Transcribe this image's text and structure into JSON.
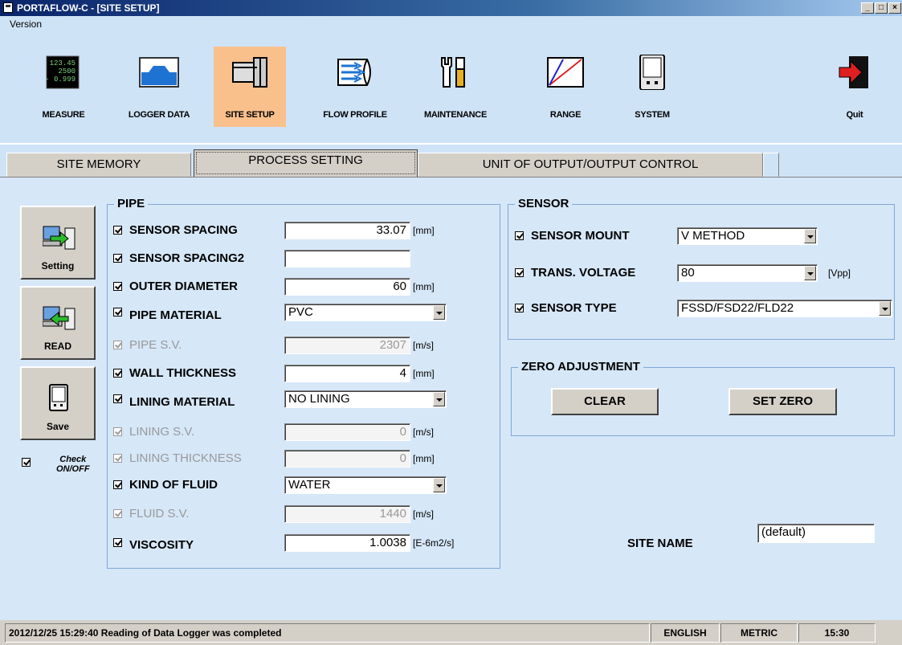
{
  "window": {
    "title": "PORTAFLOW-C - [SITE SETUP]",
    "controls": [
      "_",
      "□",
      "×"
    ]
  },
  "menu": {
    "items": [
      "Version"
    ]
  },
  "toolbar": {
    "items": [
      {
        "label": "MEASURE",
        "icon": "measure-display-icon",
        "display_lines": [
          "123.45",
          "2500",
          "- 0.999"
        ]
      },
      {
        "label": "LOGGER DATA",
        "icon": "logger-data-icon"
      },
      {
        "label": "SITE SETUP",
        "icon": "pipe-icon",
        "active": true
      },
      {
        "label": "FLOW PROFILE",
        "icon": "flow-profile-icon"
      },
      {
        "label": "MAINTENANCE",
        "icon": "tools-icon"
      },
      {
        "label": "RANGE",
        "icon": "range-graph-icon"
      },
      {
        "label": "SYSTEM",
        "icon": "device-icon"
      },
      {
        "label": "Quit",
        "icon": "exit-door-icon"
      }
    ]
  },
  "tabs": [
    {
      "label": "SITE MEMORY"
    },
    {
      "label": "PROCESS SETTING",
      "active": true
    },
    {
      "label": "UNIT OF OUTPUT/OUTPUT CONTROL"
    }
  ],
  "side_buttons": {
    "setting": "Setting",
    "read": "READ",
    "save": "Save",
    "check_onoff": [
      "Check",
      "ON/OFF"
    ]
  },
  "pipe": {
    "title": "PIPE",
    "rows": [
      {
        "label": "SENSOR SPACING",
        "value": "33.07",
        "unit": "[mm]"
      },
      {
        "label": "SENSOR SPACING2",
        "value": "",
        "unit": ""
      },
      {
        "label": "OUTER DIAMETER",
        "value": "60",
        "unit": "[mm]"
      },
      {
        "label": "PIPE MATERIAL",
        "value": "PVC",
        "unit": ""
      },
      {
        "label": "PIPE S.V.",
        "value": "2307",
        "unit": "[m/s]"
      },
      {
        "label": "WALL THICKNESS",
        "value": "4",
        "unit": "[mm]"
      },
      {
        "label": "LINING MATERIAL",
        "value": "NO LINING",
        "unit": ""
      },
      {
        "label": "LINING S.V.",
        "value": "0",
        "unit": "[m/s]"
      },
      {
        "label": "LINING THICKNESS",
        "value": "0",
        "unit": "[mm]"
      },
      {
        "label": "KIND OF FLUID",
        "value": "WATER",
        "unit": ""
      },
      {
        "label": "FLUID S.V.",
        "value": "1440",
        "unit": "[m/s]"
      },
      {
        "label": "VISCOSITY",
        "value": "1.0038",
        "unit": "[E-6m2/s]"
      }
    ]
  },
  "sensor": {
    "title": "SENSOR",
    "rows": [
      {
        "label": "SENSOR MOUNT",
        "value": "V METHOD",
        "unit": ""
      },
      {
        "label": "TRANS. VOLTAGE",
        "value": "80",
        "unit": "[Vpp]"
      },
      {
        "label": "SENSOR TYPE",
        "value": "FSSD/FSD22/FLD22",
        "unit": ""
      }
    ]
  },
  "zero_adjustment": {
    "title": "ZERO ADJUSTMENT",
    "clear": "CLEAR",
    "set_zero": "SET ZERO"
  },
  "site_name": {
    "label": "SITE NAME",
    "value": "(default)"
  },
  "status": {
    "message": "2012/12/25 15:29:40 Reading of Data Logger was completed",
    "language": "ENGLISH",
    "units": "METRIC",
    "time": "15:30"
  },
  "colors": {
    "active_tool": "#f9c08c",
    "panel_bg": "#d6e7f8",
    "group_border": "#7fa8d6",
    "disabled_text": "#999999"
  }
}
